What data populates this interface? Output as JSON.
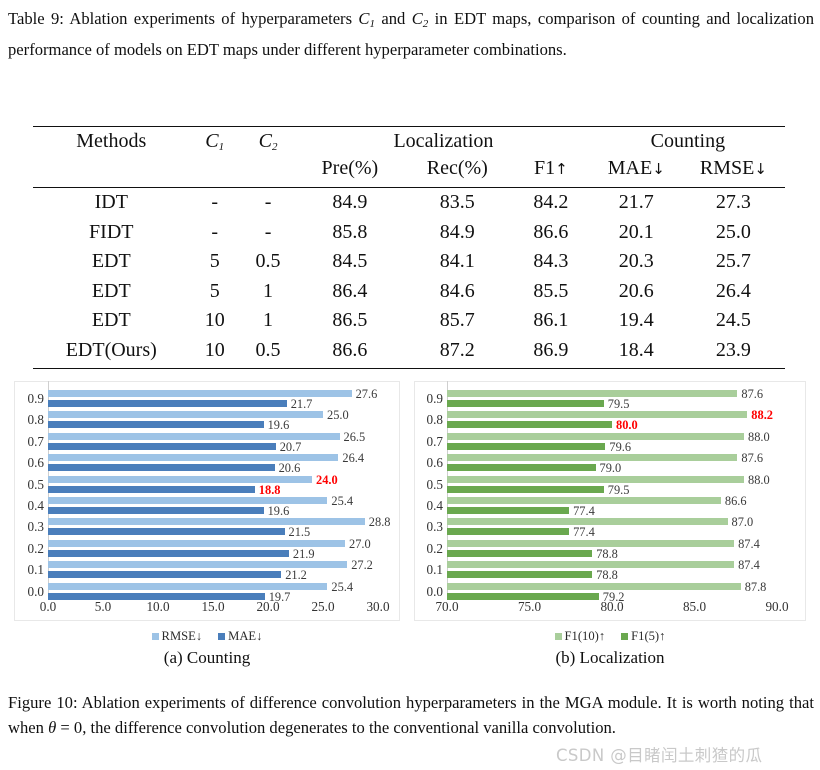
{
  "table_caption": {
    "label": "Table 9:",
    "text_part1": " Ablation experiments of hyperparameters ",
    "c1": "C",
    "c1_sub": "1",
    "and": " and ",
    "c2": "C",
    "c2_sub": "2",
    "text_part2": " in EDT maps, comparison of counting and localization performance of models on EDT maps under different hyperparameter combinations."
  },
  "figure_caption": {
    "label": "Figure 10:",
    "text_part1": " Ablation experiments of difference convolution hyperparameters in the MGA module. It is worth noting that when ",
    "theta": "θ",
    "eq": " = 0",
    "text_part2": ", the difference convolution degenerates to the conventional vanilla convolution."
  },
  "table": {
    "group_headers": {
      "methods": "Methods",
      "c1": "C",
      "c1_sub": "1",
      "c2": "C",
      "c2_sub": "2",
      "localization": "Localization",
      "counting": "Counting"
    },
    "sub_headers": {
      "pre": "Pre(%)",
      "rec": "Rec(%)",
      "f1": "F1",
      "f1_arrow": "↑",
      "mae": "MAE",
      "mae_arrow": "↓",
      "rmse": "RMSE",
      "rmse_arrow": "↓"
    },
    "rows": [
      {
        "method": "IDT",
        "c1": "-",
        "c2": "-",
        "pre": "84.9",
        "rec": "83.5",
        "f1": "84.2",
        "mae": "21.7",
        "rmse": "27.3",
        "bold": false
      },
      {
        "method": "FIDT",
        "c1": "-",
        "c2": "-",
        "pre": "85.8",
        "rec": "84.9",
        "f1": "86.6",
        "mae": "20.1",
        "rmse": "25.0",
        "bold": false
      },
      {
        "method": "EDT",
        "c1": "5",
        "c2": "0.5",
        "pre": "84.5",
        "rec": "84.1",
        "f1": "84.3",
        "mae": "20.3",
        "rmse": "25.7",
        "bold": false
      },
      {
        "method": "EDT",
        "c1": "5",
        "c2": "1",
        "pre": "86.4",
        "rec": "84.6",
        "f1": "85.5",
        "mae": "20.6",
        "rmse": "26.4",
        "bold": false
      },
      {
        "method": "EDT",
        "c1": "10",
        "c2": "1",
        "pre": "86.5",
        "rec": "85.7",
        "f1": "86.1",
        "mae": "19.4",
        "rmse": "24.5",
        "bold": false
      },
      {
        "method": "EDT(Ours)",
        "c1": "10",
        "c2": "0.5",
        "pre": "86.6",
        "rec": "87.2",
        "f1": "86.9",
        "mae": "18.4",
        "rmse": "23.9",
        "bold": true
      }
    ]
  },
  "chart_data": [
    {
      "type": "bar",
      "id": "counting",
      "title": "(a) Counting",
      "orientation": "horizontal",
      "categories": [
        "0.9",
        "0.8",
        "0.7",
        "0.6",
        "0.5",
        "0.4",
        "0.3",
        "0.2",
        "0.1",
        "0.0"
      ],
      "series": [
        {
          "name": "RMSE↓",
          "color": "#9DC3E6",
          "values": [
            27.6,
            25.0,
            26.5,
            26.4,
            24.0,
            25.4,
            28.8,
            27.0,
            27.2,
            25.4
          ]
        },
        {
          "name": "MAE↓",
          "color": "#4A7EBB",
          "values": [
            21.7,
            19.6,
            20.7,
            20.6,
            18.8,
            19.6,
            21.5,
            21.9,
            21.2,
            19.7
          ]
        }
      ],
      "highlighted": [
        "24.0",
        "18.8"
      ],
      "highlight_color": "#ff0000",
      "xlim": [
        0.0,
        30.0
      ],
      "xticks": [
        "0.0",
        "5.0",
        "10.0",
        "15.0",
        "20.0",
        "25.0",
        "30.0"
      ],
      "xlabel": "",
      "ylabel": "",
      "grid": false,
      "legend_position": "bottom"
    },
    {
      "type": "bar",
      "id": "localization",
      "title": "(b) Localization",
      "orientation": "horizontal",
      "categories": [
        "0.9",
        "0.8",
        "0.7",
        "0.6",
        "0.5",
        "0.4",
        "0.3",
        "0.2",
        "0.1",
        "0.0"
      ],
      "series": [
        {
          "name": "F1(10)↑",
          "color": "#A9CE9B",
          "values": [
            87.6,
            88.2,
            88.0,
            87.6,
            88.0,
            86.6,
            87.0,
            87.4,
            87.4,
            87.8
          ]
        },
        {
          "name": "F1(5)↑",
          "color": "#6AA84F",
          "values": [
            79.5,
            80.0,
            79.6,
            79.0,
            79.5,
            77.4,
            77.4,
            78.8,
            78.8,
            79.2
          ]
        }
      ],
      "highlighted": [
        "88.2",
        "80.0"
      ],
      "highlight_color": "#ff0000",
      "xlim": [
        70.0,
        90.0
      ],
      "xticks": [
        "70.0",
        "75.0",
        "80.0",
        "85.0",
        "90.0"
      ],
      "xlabel": "",
      "ylabel": "",
      "grid": false,
      "legend_position": "bottom"
    }
  ],
  "watermark": "CSDN @目睹闰土刺猹的瓜"
}
